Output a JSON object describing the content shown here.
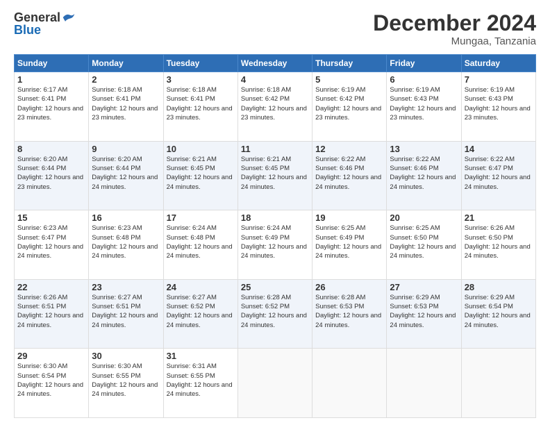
{
  "header": {
    "logo_general": "General",
    "logo_blue": "Blue",
    "title": "December 2024",
    "subtitle": "Mungaa, Tanzania"
  },
  "days_of_week": [
    "Sunday",
    "Monday",
    "Tuesday",
    "Wednesday",
    "Thursday",
    "Friday",
    "Saturday"
  ],
  "weeks": [
    [
      {
        "day": 1,
        "sunrise": "6:17 AM",
        "sunset": "6:41 PM",
        "daylight": "12 hours and 23 minutes."
      },
      {
        "day": 2,
        "sunrise": "6:18 AM",
        "sunset": "6:41 PM",
        "daylight": "12 hours and 23 minutes."
      },
      {
        "day": 3,
        "sunrise": "6:18 AM",
        "sunset": "6:41 PM",
        "daylight": "12 hours and 23 minutes."
      },
      {
        "day": 4,
        "sunrise": "6:18 AM",
        "sunset": "6:42 PM",
        "daylight": "12 hours and 23 minutes."
      },
      {
        "day": 5,
        "sunrise": "6:19 AM",
        "sunset": "6:42 PM",
        "daylight": "12 hours and 23 minutes."
      },
      {
        "day": 6,
        "sunrise": "6:19 AM",
        "sunset": "6:43 PM",
        "daylight": "12 hours and 23 minutes."
      },
      {
        "day": 7,
        "sunrise": "6:19 AM",
        "sunset": "6:43 PM",
        "daylight": "12 hours and 23 minutes."
      }
    ],
    [
      {
        "day": 8,
        "sunrise": "6:20 AM",
        "sunset": "6:44 PM",
        "daylight": "12 hours and 23 minutes."
      },
      {
        "day": 9,
        "sunrise": "6:20 AM",
        "sunset": "6:44 PM",
        "daylight": "12 hours and 24 minutes."
      },
      {
        "day": 10,
        "sunrise": "6:21 AM",
        "sunset": "6:45 PM",
        "daylight": "12 hours and 24 minutes."
      },
      {
        "day": 11,
        "sunrise": "6:21 AM",
        "sunset": "6:45 PM",
        "daylight": "12 hours and 24 minutes."
      },
      {
        "day": 12,
        "sunrise": "6:22 AM",
        "sunset": "6:46 PM",
        "daylight": "12 hours and 24 minutes."
      },
      {
        "day": 13,
        "sunrise": "6:22 AM",
        "sunset": "6:46 PM",
        "daylight": "12 hours and 24 minutes."
      },
      {
        "day": 14,
        "sunrise": "6:22 AM",
        "sunset": "6:47 PM",
        "daylight": "12 hours and 24 minutes."
      }
    ],
    [
      {
        "day": 15,
        "sunrise": "6:23 AM",
        "sunset": "6:47 PM",
        "daylight": "12 hours and 24 minutes."
      },
      {
        "day": 16,
        "sunrise": "6:23 AM",
        "sunset": "6:48 PM",
        "daylight": "12 hours and 24 minutes."
      },
      {
        "day": 17,
        "sunrise": "6:24 AM",
        "sunset": "6:48 PM",
        "daylight": "12 hours and 24 minutes."
      },
      {
        "day": 18,
        "sunrise": "6:24 AM",
        "sunset": "6:49 PM",
        "daylight": "12 hours and 24 minutes."
      },
      {
        "day": 19,
        "sunrise": "6:25 AM",
        "sunset": "6:49 PM",
        "daylight": "12 hours and 24 minutes."
      },
      {
        "day": 20,
        "sunrise": "6:25 AM",
        "sunset": "6:50 PM",
        "daylight": "12 hours and 24 minutes."
      },
      {
        "day": 21,
        "sunrise": "6:26 AM",
        "sunset": "6:50 PM",
        "daylight": "12 hours and 24 minutes."
      }
    ],
    [
      {
        "day": 22,
        "sunrise": "6:26 AM",
        "sunset": "6:51 PM",
        "daylight": "12 hours and 24 minutes."
      },
      {
        "day": 23,
        "sunrise": "6:27 AM",
        "sunset": "6:51 PM",
        "daylight": "12 hours and 24 minutes."
      },
      {
        "day": 24,
        "sunrise": "6:27 AM",
        "sunset": "6:52 PM",
        "daylight": "12 hours and 24 minutes."
      },
      {
        "day": 25,
        "sunrise": "6:28 AM",
        "sunset": "6:52 PM",
        "daylight": "12 hours and 24 minutes."
      },
      {
        "day": 26,
        "sunrise": "6:28 AM",
        "sunset": "6:53 PM",
        "daylight": "12 hours and 24 minutes."
      },
      {
        "day": 27,
        "sunrise": "6:29 AM",
        "sunset": "6:53 PM",
        "daylight": "12 hours and 24 minutes."
      },
      {
        "day": 28,
        "sunrise": "6:29 AM",
        "sunset": "6:54 PM",
        "daylight": "12 hours and 24 minutes."
      }
    ],
    [
      {
        "day": 29,
        "sunrise": "6:30 AM",
        "sunset": "6:54 PM",
        "daylight": "12 hours and 24 minutes."
      },
      {
        "day": 30,
        "sunrise": "6:30 AM",
        "sunset": "6:55 PM",
        "daylight": "12 hours and 24 minutes."
      },
      {
        "day": 31,
        "sunrise": "6:31 AM",
        "sunset": "6:55 PM",
        "daylight": "12 hours and 24 minutes."
      },
      null,
      null,
      null,
      null
    ]
  ]
}
